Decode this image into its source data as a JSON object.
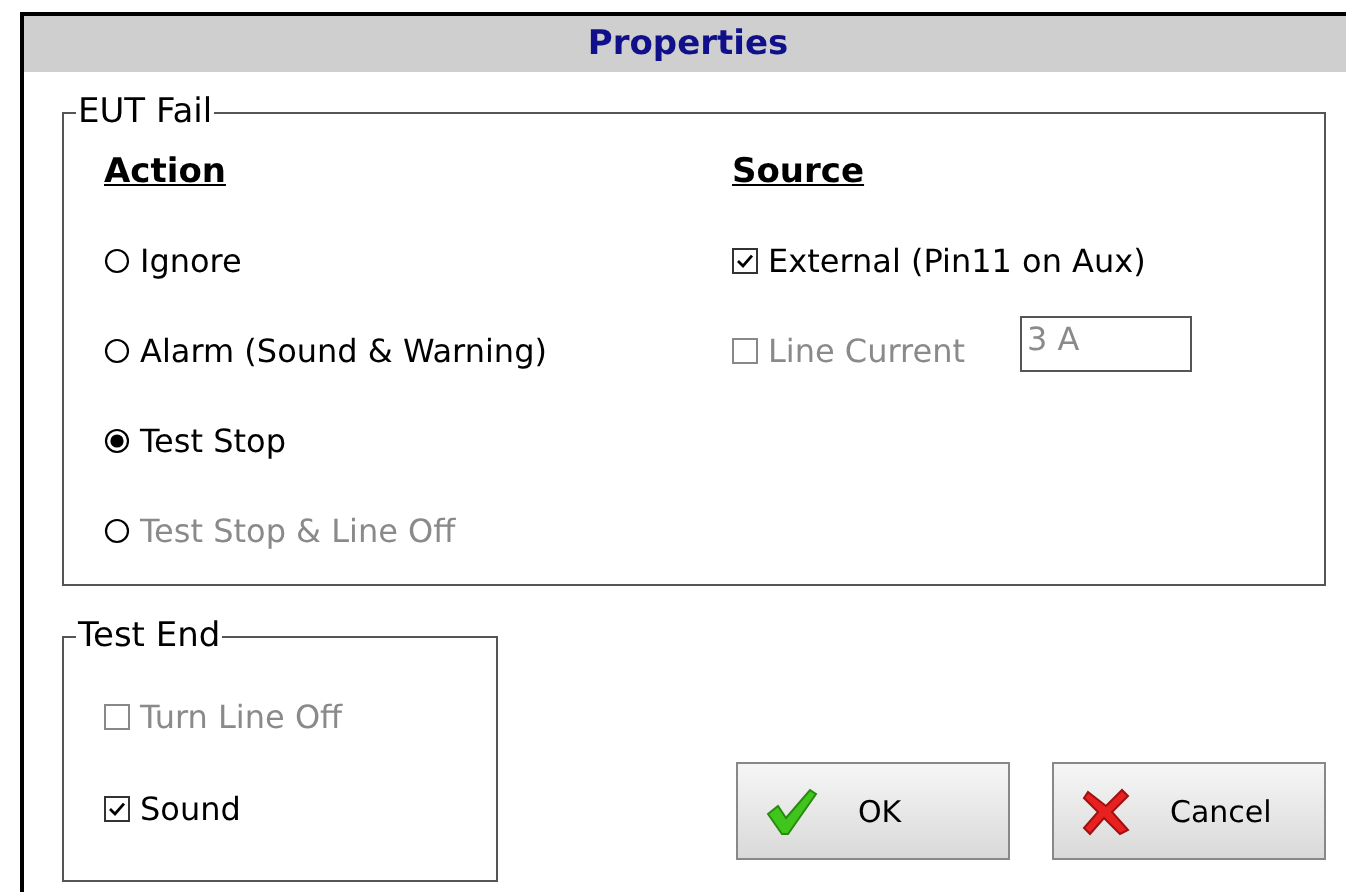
{
  "window": {
    "title": "Properties"
  },
  "eut_fail": {
    "label": "EUT Fail",
    "action": {
      "heading": "Action",
      "options": [
        {
          "label": "Ignore",
          "selected": false,
          "disabled": false
        },
        {
          "label": "Alarm (Sound & Warning)",
          "selected": false,
          "disabled": false
        },
        {
          "label": "Test Stop",
          "selected": true,
          "disabled": false
        },
        {
          "label": "Test Stop & Line Off",
          "selected": false,
          "disabled": true
        }
      ]
    },
    "source": {
      "heading": "Source",
      "items": [
        {
          "kind": "checkbox",
          "label": "External (Pin11 on Aux)",
          "checked": true,
          "disabled": false
        },
        {
          "kind": "checkbox_field",
          "label": "Line Current",
          "checked": false,
          "disabled": true,
          "value": "3 A"
        }
      ]
    }
  },
  "test_end": {
    "label": "Test End",
    "items": [
      {
        "label": "Turn Line Off",
        "checked": false,
        "disabled": true
      },
      {
        "label": "Sound",
        "checked": true,
        "disabled": false
      }
    ]
  },
  "buttons": [
    {
      "kind": "ok",
      "label": "OK"
    },
    {
      "kind": "cancel",
      "label": "Cancel"
    }
  ]
}
